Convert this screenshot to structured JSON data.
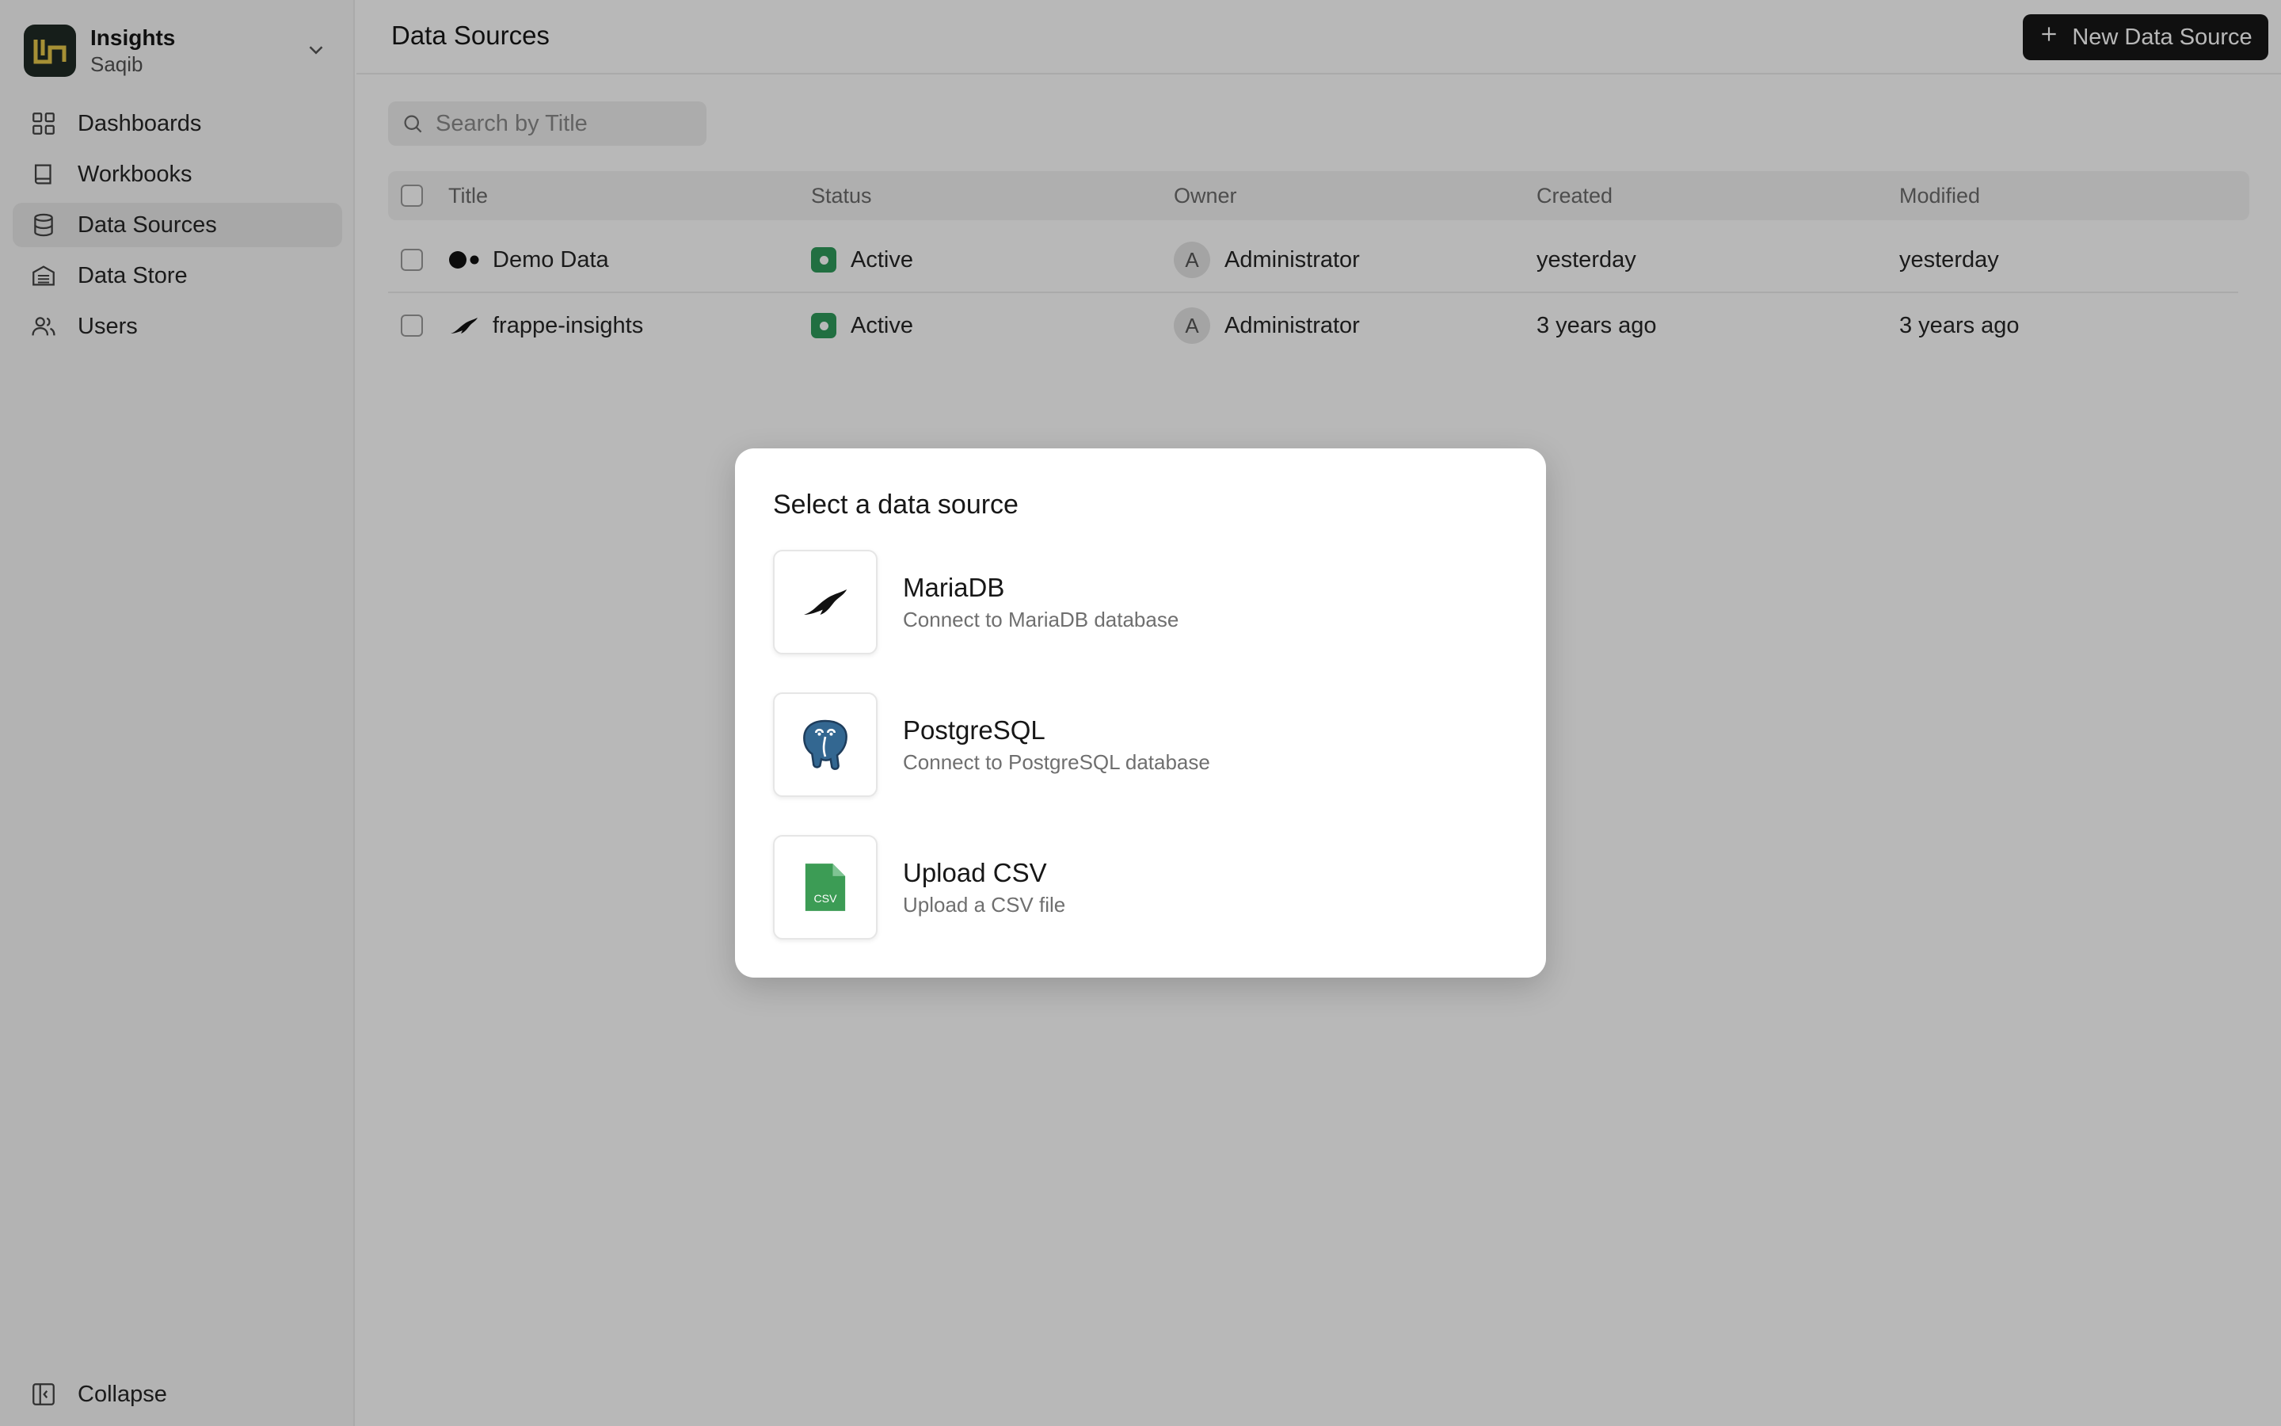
{
  "sidebar": {
    "brand": {
      "title": "Insights",
      "subtitle": "Saqib"
    },
    "items": [
      {
        "label": "Dashboards",
        "icon": "grid-icon"
      },
      {
        "label": "Workbooks",
        "icon": "book-icon"
      },
      {
        "label": "Data Sources",
        "icon": "database-icon",
        "active": true
      },
      {
        "label": "Data Store",
        "icon": "warehouse-icon"
      },
      {
        "label": "Users",
        "icon": "users-icon"
      }
    ],
    "collapse_label": "Collapse"
  },
  "header": {
    "title": "Data Sources",
    "new_button_label": "New Data Source"
  },
  "search": {
    "placeholder": "Search by Title",
    "value": ""
  },
  "table": {
    "columns": [
      "Title",
      "Status",
      "Owner",
      "Created",
      "Modified"
    ],
    "rows": [
      {
        "title": "Demo Data",
        "icon": "demo-data-icon",
        "status": "Active",
        "owner_initial": "A",
        "owner": "Administrator",
        "created": "yesterday",
        "modified": "yesterday"
      },
      {
        "title": "frappe-insights",
        "icon": "mariadb-seal-icon",
        "status": "Active",
        "owner_initial": "A",
        "owner": "Administrator",
        "created": "3 years ago",
        "modified": "3 years ago"
      }
    ]
  },
  "dialog": {
    "title": "Select a data source",
    "options": [
      {
        "title": "MariaDB",
        "description": "Connect to MariaDB database",
        "icon": "mariadb-icon"
      },
      {
        "title": "PostgreSQL",
        "description": "Connect to PostgreSQL database",
        "icon": "postgresql-icon"
      },
      {
        "title": "Upload CSV",
        "description": "Upload a CSV file",
        "icon": "csv-file-icon",
        "icon_text": "CSV"
      }
    ]
  },
  "colors": {
    "accent_dark": "#171717",
    "status_active": "#2f9a5a",
    "logo_bg": "#1f2a24",
    "logo_fg": "#e6c84a",
    "csv_green": "#3c9c55",
    "postgres_blue": "#336791"
  }
}
